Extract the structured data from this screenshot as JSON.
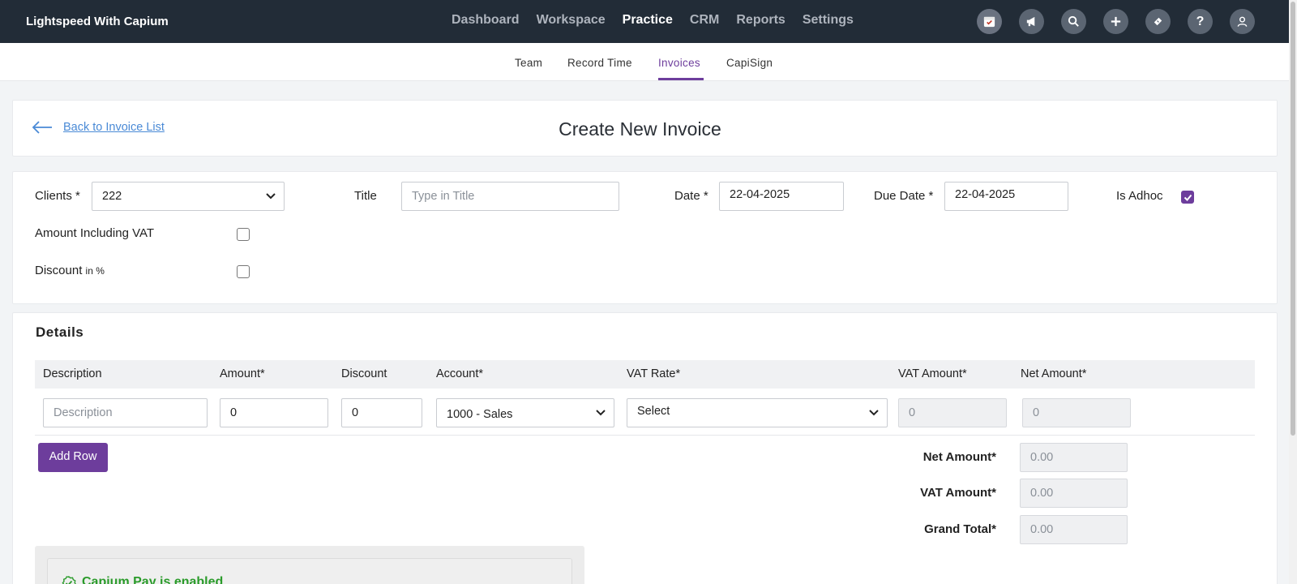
{
  "brand": "Lightspeed With Capium",
  "main_nav": [
    "Dashboard",
    "Workspace",
    "Practice",
    "CRM",
    "Reports",
    "Settings"
  ],
  "main_nav_active": "Practice",
  "tool_icons": [
    "calendar-icon",
    "megaphone-icon",
    "search-icon",
    "plus-icon",
    "ticket-icon",
    "help-icon",
    "user-icon"
  ],
  "sub_nav": {
    "team": "Team",
    "record_time": "Record Time",
    "invoices": "Invoices",
    "capisign": "CapiSign",
    "active": "Invoices"
  },
  "header": {
    "back_link": "Back to Invoice List",
    "title": "Create New Invoice"
  },
  "form": {
    "clients_label": "Clients *",
    "clients_value": "222",
    "title_label": "Title",
    "title_placeholder": "Type in Title",
    "date_label": "Date *",
    "date_value": "22-04-2025",
    "due_date_label": "Due Date *",
    "due_date_value": "22-04-2025",
    "is_adhoc_label": "Is Adhoc",
    "is_adhoc_checked": true,
    "amount_incl_vat_label": "Amount Including VAT",
    "amount_incl_vat_checked": false,
    "discount_label": "Discount",
    "discount_sub": "in %",
    "discount_checked": false
  },
  "details": {
    "heading": "Details",
    "columns": [
      "Description",
      "Amount*",
      "Discount",
      "Account*",
      "VAT Rate*",
      "VAT Amount*",
      "Net Amount*"
    ],
    "row": {
      "description_placeholder": "Description",
      "amount": "0",
      "discount": "0",
      "account": "1000 - Sales",
      "vat_rate": "Select",
      "vat_amount": "0",
      "net_amount": "0"
    },
    "add_row_label": "Add Row"
  },
  "totals": {
    "net_amount_label": "Net Amount*",
    "net_amount": "0.00",
    "vat_amount_label": "VAT Amount*",
    "vat_amount": "0.00",
    "grand_total_label": "Grand Total*",
    "grand_total": "0.00"
  },
  "capium_pay": {
    "text": "Capium Pay is enabled"
  },
  "colors": {
    "topbar": "#222c37",
    "accent": "#6d3d9c",
    "link": "#4a8ad6",
    "success": "#2a9b2a"
  }
}
